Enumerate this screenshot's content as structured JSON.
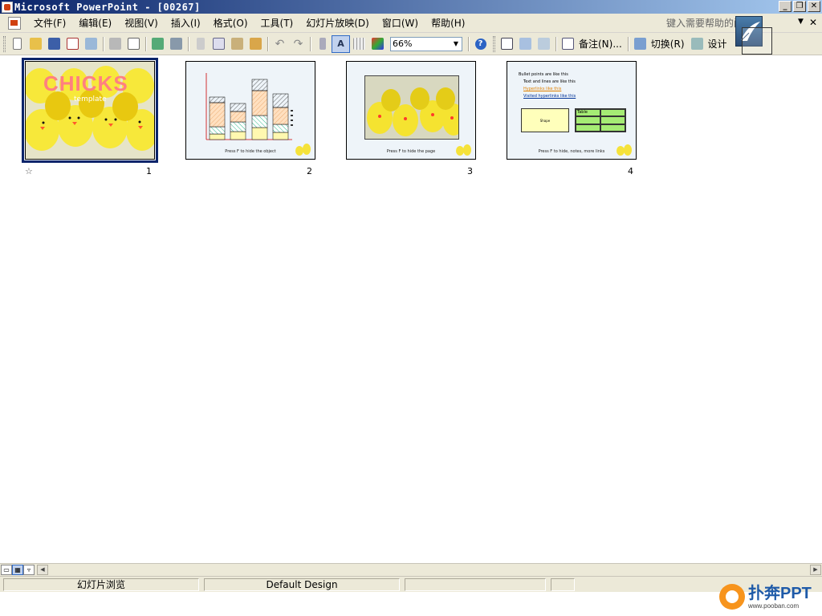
{
  "window": {
    "title": "Microsoft PowerPoint - [00267]",
    "buttons": [
      "_",
      "❐",
      "✕"
    ]
  },
  "menu": {
    "items": [
      "文件(F)",
      "编辑(E)",
      "视图(V)",
      "插入(I)",
      "格式(O)",
      "工具(T)",
      "幻灯片放映(D)",
      "窗口(W)",
      "帮助(H)"
    ],
    "help_placeholder": "键入需要帮助的问题"
  },
  "toolbar": {
    "zoom": "66%",
    "notes_label": "备注(N)...",
    "transition_label": "切换(R)",
    "design_label": "设计"
  },
  "slides": [
    {
      "number": "1",
      "title": "CHICKS",
      "subtitle": "template",
      "footer": ""
    },
    {
      "number": "2",
      "title": "",
      "subtitle": "",
      "footer": "Press F to hide the object"
    },
    {
      "number": "3",
      "title": "",
      "subtitle": "",
      "footer": "Press F to hide the page"
    },
    {
      "number": "4",
      "title": "",
      "subtitle": "",
      "footer": "Press F to hide, notes, more links",
      "bullets": [
        "Bullet points are like this",
        "Text and lines are like this",
        "Hyperlinks like this",
        "Visited hyperlinks like this"
      ],
      "shape_text": "Shape",
      "table_label": "Table"
    }
  ],
  "status": {
    "view": "幻灯片浏览",
    "design": "Default Design"
  },
  "brand": {
    "name": "扑奔PPT",
    "url": "www.pooban.com"
  },
  "colors": {
    "title_gradient_start": "#0a246a",
    "title_gradient_end": "#a6caf0",
    "chrome": "#ece9d8",
    "selection": "#0a246a",
    "chick_yellow": "#f4ee70",
    "cover_title": "#ff8080"
  }
}
